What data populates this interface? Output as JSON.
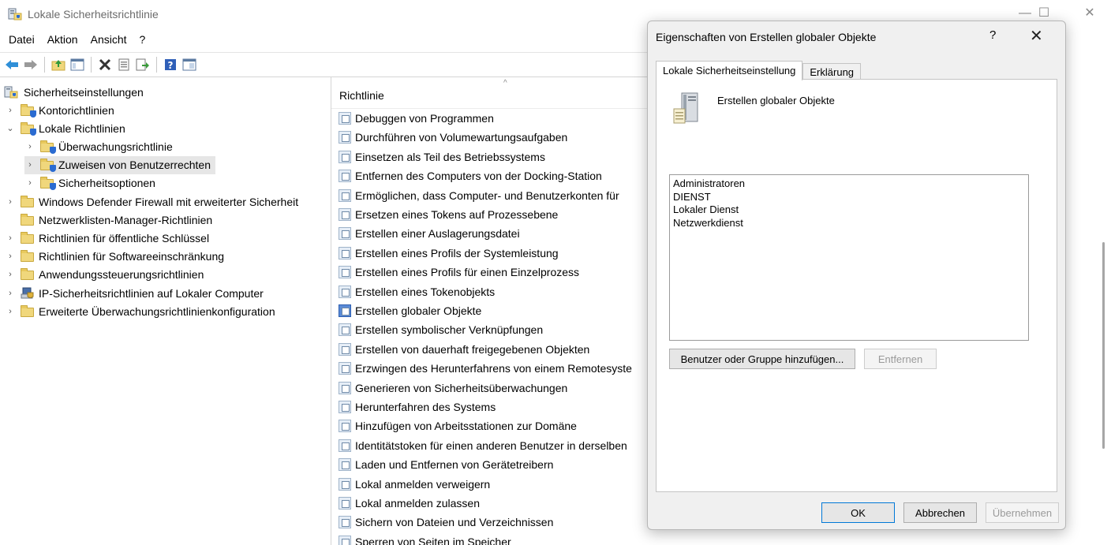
{
  "window": {
    "title": "Lokale Sicherheitsrichtlinie",
    "controls": {
      "minimize": "—",
      "maximize": "☐",
      "close": "✕"
    }
  },
  "menu": [
    "Datei",
    "Aktion",
    "Ansicht",
    "?"
  ],
  "toolbar_icons": [
    "back-arrow-icon",
    "forward-arrow-icon",
    "folder-up-icon",
    "show-hide-tree-icon",
    "delete-icon",
    "properties-icon",
    "export-icon",
    "help-icon",
    "console-tree-icon"
  ],
  "tree": {
    "root": "Sicherheitseinstellungen",
    "items": [
      {
        "label": "Kontorichtlinien",
        "expand": "›",
        "level": 1,
        "kind": "folder-shield"
      },
      {
        "label": "Lokale Richtlinien",
        "expand": "⌄",
        "level": 1,
        "kind": "folder-shield"
      },
      {
        "label": "Überwachungsrichtlinie",
        "expand": "›",
        "level": 2,
        "kind": "folder-shield"
      },
      {
        "label": "Zuweisen von Benutzerrechten",
        "expand": "›",
        "level": 2,
        "kind": "folder-shield",
        "selected": true
      },
      {
        "label": "Sicherheitsoptionen",
        "expand": "›",
        "level": 2,
        "kind": "folder-shield"
      },
      {
        "label": "Windows Defender Firewall mit erweiterter Sicherheit",
        "expand": "›",
        "level": 1,
        "kind": "folder"
      },
      {
        "label": "Netzwerklisten-Manager-Richtlinien",
        "expand": "",
        "level": 1,
        "kind": "folder"
      },
      {
        "label": "Richtlinien für öffentliche Schlüssel",
        "expand": "›",
        "level": 1,
        "kind": "folder"
      },
      {
        "label": "Richtlinien für Softwareeinschränkung",
        "expand": "›",
        "level": 1,
        "kind": "folder"
      },
      {
        "label": "Anwendungssteuerungsrichtlinien",
        "expand": "›",
        "level": 1,
        "kind": "folder"
      },
      {
        "label": "IP-Sicherheitsrichtlinien auf Lokaler Computer",
        "expand": "›",
        "level": 1,
        "kind": "ipsec"
      },
      {
        "label": "Erweiterte Überwachungsrichtlinienkonfiguration",
        "expand": "›",
        "level": 1,
        "kind": "folder"
      }
    ]
  },
  "list": {
    "column": "Richtlinie",
    "sort_indicator": "^",
    "rows": [
      "Debuggen von Programmen",
      "Durchführen von Volumewartungsaufgaben",
      "Einsetzen als Teil des Betriebssystems",
      "Entfernen des Computers von der Docking-Station",
      "Ermöglichen, dass Computer- und Benutzerkonten für",
      "Ersetzen eines Tokens auf Prozessebene",
      "Erstellen einer Auslagerungsdatei",
      "Erstellen eines Profils der Systemleistung",
      "Erstellen eines Profils für einen Einzelprozess",
      "Erstellen eines Tokenobjekts",
      "Erstellen globaler Objekte",
      "Erstellen symbolischer Verknüpfungen",
      "Erstellen von dauerhaft freigegebenen Objekten",
      "Erzwingen des Herunterfahrens von einem Remotesyste",
      "Generieren von Sicherheitsüberwachungen",
      "Herunterfahren des Systems",
      "Hinzufügen von Arbeitsstationen zur Domäne",
      "Identitätstoken für einen anderen Benutzer in derselben",
      "Laden und Entfernen von Gerätetreibern",
      "Lokal anmelden verweigern",
      "Lokal anmelden zulassen",
      "Sichern von Dateien und Verzeichnissen",
      "Sperren von Seiten im Speicher"
    ],
    "selected_index": 10
  },
  "dialog": {
    "title": "Eigenschaften von Erstellen globaler Objekte",
    "help": "?",
    "close": "✕",
    "tabs": [
      "Lokale Sicherheitseinstellung",
      "Erklärung"
    ],
    "policy_name": "Erstellen globaler Objekte",
    "members": [
      "Administratoren",
      "DIENST",
      "Lokaler Dienst",
      "Netzwerkdienst"
    ],
    "add_button": "Benutzer oder Gruppe hinzufügen...",
    "remove_button": "Entfernen",
    "ok_button": "OK",
    "cancel_button": "Abbrechen",
    "apply_button": "Übernehmen"
  }
}
